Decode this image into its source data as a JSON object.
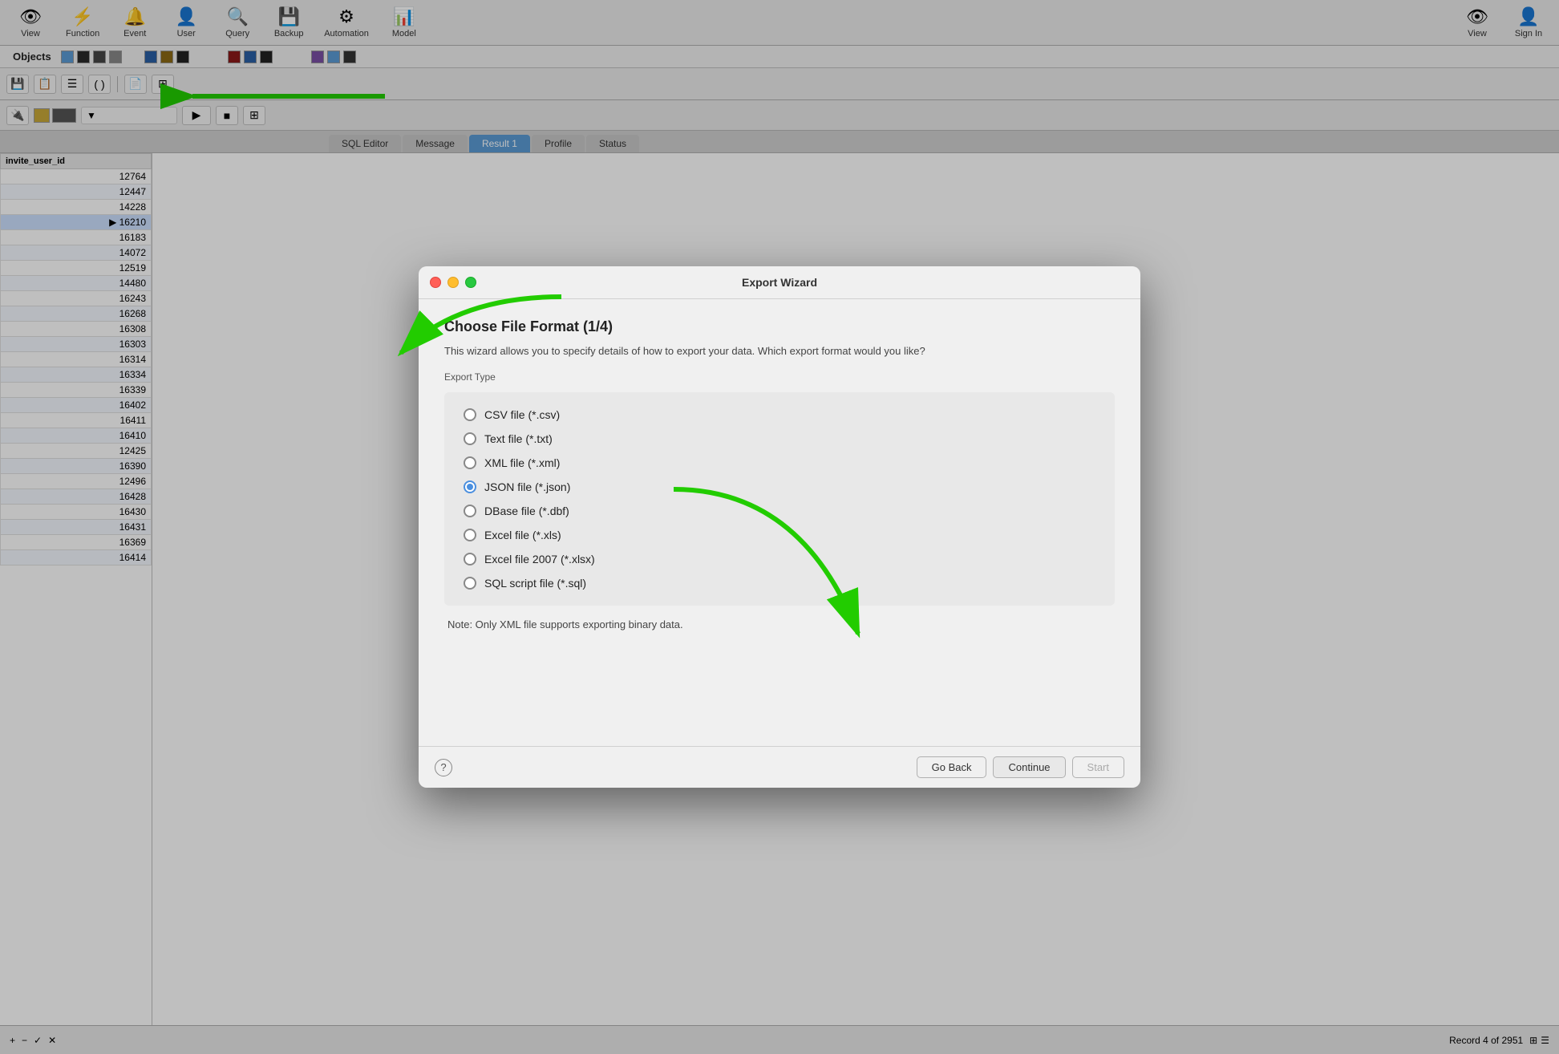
{
  "window_title": "Export Wizard",
  "toolbar": {
    "items": [
      {
        "id": "view",
        "label": "View",
        "icon": "👁"
      },
      {
        "id": "function",
        "label": "Function",
        "icon": "⚡"
      },
      {
        "id": "event",
        "label": "Event",
        "icon": "🔔"
      },
      {
        "id": "user",
        "label": "User",
        "icon": "👤"
      },
      {
        "id": "query",
        "label": "Query",
        "icon": "🔍"
      },
      {
        "id": "backup",
        "label": "Backup",
        "icon": "💾"
      },
      {
        "id": "automation",
        "label": "Automation",
        "icon": "⚙"
      },
      {
        "id": "model",
        "label": "Model",
        "icon": "📊"
      }
    ],
    "right_items": [
      {
        "id": "view2",
        "label": "View",
        "icon": "👁"
      },
      {
        "id": "signin",
        "label": "Sign In",
        "icon": "👤"
      }
    ]
  },
  "left_panel": {
    "header": "Objects",
    "column": "invite_user_id",
    "rows": [
      {
        "value": "12764",
        "selected": false
      },
      {
        "value": "12447",
        "selected": false
      },
      {
        "value": "14228",
        "selected": false
      },
      {
        "value": "16210",
        "selected": true,
        "arrow": true
      },
      {
        "value": "16183",
        "selected": false
      },
      {
        "value": "14072",
        "selected": false
      },
      {
        "value": "12519",
        "selected": false
      },
      {
        "value": "14480",
        "selected": false
      },
      {
        "value": "16243",
        "selected": false
      },
      {
        "value": "16268",
        "selected": false
      },
      {
        "value": "16308",
        "selected": false
      },
      {
        "value": "16303",
        "selected": false
      },
      {
        "value": "16314",
        "selected": false
      },
      {
        "value": "16334",
        "selected": false
      },
      {
        "value": "16339",
        "selected": false
      },
      {
        "value": "16402",
        "selected": false
      },
      {
        "value": "16411",
        "selected": false
      },
      {
        "value": "16410",
        "selected": false
      },
      {
        "value": "12425",
        "selected": false
      },
      {
        "value": "16390",
        "selected": false
      },
      {
        "value": "12496",
        "selected": false
      },
      {
        "value": "16428",
        "selected": false
      },
      {
        "value": "16430",
        "selected": false
      },
      {
        "value": "16431",
        "selected": false
      },
      {
        "value": "16369",
        "selected": false
      },
      {
        "value": "16414",
        "selected": false
      }
    ]
  },
  "tabs": [
    {
      "id": "sql-editor",
      "label": "SQL Editor",
      "active": false
    },
    {
      "id": "message",
      "label": "Message",
      "active": false
    },
    {
      "id": "result-1",
      "label": "Result 1",
      "active": true
    },
    {
      "id": "profile",
      "label": "Profile",
      "active": false
    },
    {
      "id": "status",
      "label": "Status",
      "active": false
    }
  ],
  "modal": {
    "title": "Export Wizard",
    "step_title": "Choose File Format (1/4)",
    "description": "This wizard allows you to specify details of how to export your data. Which export format would you like?",
    "export_type_label": "Export Type",
    "options": [
      {
        "id": "csv",
        "label": "CSV file (*.csv)",
        "selected": false
      },
      {
        "id": "txt",
        "label": "Text file (*.txt)",
        "selected": false
      },
      {
        "id": "xml",
        "label": "XML file (*.xml)",
        "selected": false
      },
      {
        "id": "json",
        "label": "JSON file (*.json)",
        "selected": true
      },
      {
        "id": "dbf",
        "label": "DBase file (*.dbf)",
        "selected": false
      },
      {
        "id": "xls",
        "label": "Excel file (*.xls)",
        "selected": false
      },
      {
        "id": "xlsx",
        "label": "Excel file 2007 (*.xlsx)",
        "selected": false
      },
      {
        "id": "sql",
        "label": "SQL script file (*.sql)",
        "selected": false
      }
    ],
    "note": "Note: Only XML file supports exporting binary data.",
    "buttons": {
      "help": "?",
      "go_back": "Go Back",
      "continue": "Continue",
      "start": "Start"
    }
  },
  "status_bar": {
    "record_info": "Record 4 of 2951"
  }
}
